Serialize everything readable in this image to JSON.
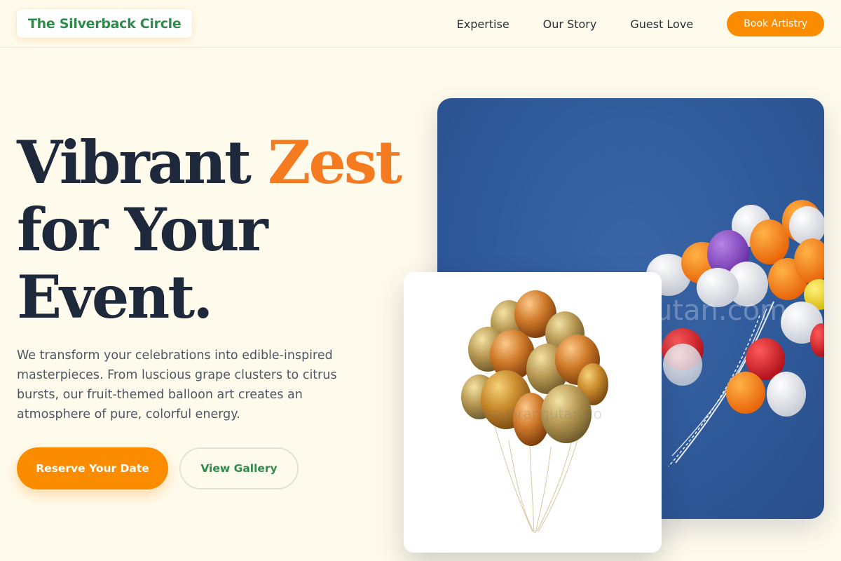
{
  "header": {
    "logo": "The Silverback Circle",
    "nav": [
      "Expertise",
      "Our Story",
      "Guest Love"
    ],
    "cta": "Book Artistry"
  },
  "hero": {
    "headline_part1": "Vibrant ",
    "headline_accent": "Zest",
    "headline_line2": "for Your",
    "headline_line3": "Event.",
    "lead": "We transform your celebrations into edible-inspired masterpieces. From luscious grape clusters to citrus bursts, our fruit-themed balloon art creates an atmosphere of pure, colorful energy.",
    "primary_button": "Reserve Your Date",
    "secondary_button": "View Gallery"
  },
  "images": {
    "sky_watermark": "utan.com",
    "gold_watermark": "unnyorangutan.co"
  },
  "colors": {
    "background": "#fffbec",
    "accent_orange": "#fb8c00",
    "headline_accent": "#f47b20",
    "brand_green": "#2f8a4c",
    "headline_text": "#1d283a"
  }
}
